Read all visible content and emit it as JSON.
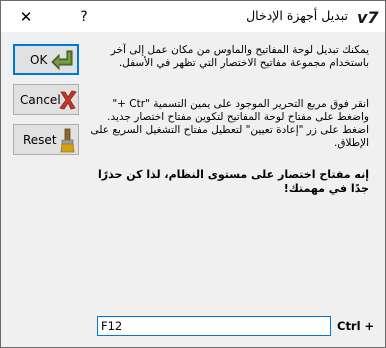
{
  "window": {
    "title": "تبديل أجهزة الإدخال",
    "app_icon_text": "V7",
    "help_label": "?",
    "close_label": "✕"
  },
  "buttons": {
    "ok_label": "OK",
    "cancel_label": "Cancel",
    "reset_label": "Reset"
  },
  "instructions": {
    "paragraph1": "يمكنك تبديل لوحة المفاتيح والماوس من مكان عمل إلى آخر باستخدام مجموعة مفاتيح الاختصار التي تظهر في الأسفل.",
    "paragraph2": "انقر فوق مربع التحرير الموجود على يمين التسمية \"Ctr +\" واضغط على مفتاح لوحة المفاتيح لتكوين مفتاح اختصار جديد. اضغط على زر \"إعادة تعيين\" لتعطيل مفتاح التشغيل السريع على الإطلاق.",
    "warning": "إنه مفتاح اختصار على مستوى النظام، لذا كن حذرًا جدًا في مهمتك!"
  },
  "shortcut": {
    "modifier_label": "Ctrl +",
    "value": "F12"
  },
  "colors": {
    "accent": "#0078d7",
    "ok_arrow": "#5a7a2e",
    "cancel_x": "#c0392b",
    "reset_brush": "#d4a017"
  }
}
